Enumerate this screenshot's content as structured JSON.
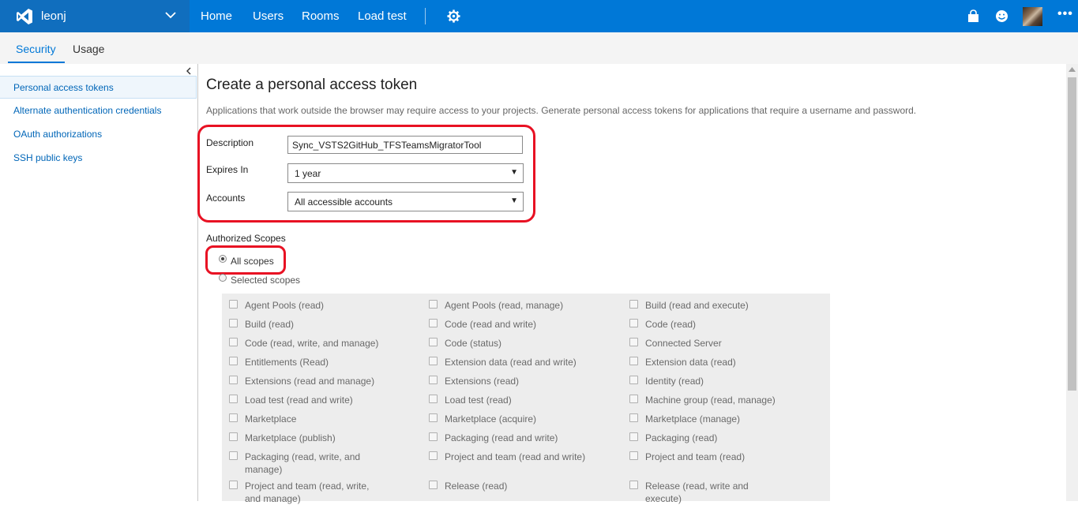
{
  "topbar": {
    "account_name": "leonj",
    "nav": [
      "Home",
      "Users",
      "Rooms",
      "Load test"
    ],
    "icons": [
      "visual-studio-logo",
      "chevron-down-icon",
      "gear-icon",
      "shopping-bag-icon",
      "smiley-feedback-icon",
      "avatar",
      "more-icon"
    ]
  },
  "subnav": {
    "tabs": [
      "Security",
      "Usage"
    ],
    "active": "Security"
  },
  "sidebar": {
    "items": [
      "Personal access tokens",
      "Alternate authentication credentials",
      "OAuth authorizations",
      "SSH public keys"
    ],
    "selected": "Personal access tokens"
  },
  "main": {
    "title": "Create a personal access token",
    "description": "Applications that work outside the browser may require access to your projects. Generate personal access tokens for applications that require a username and password.",
    "form": {
      "description_label": "Description",
      "description_value": "Sync_VSTS2GitHub_TFSTeamsMigratorTool",
      "expires_label": "Expires In",
      "expires_value": "1 year",
      "accounts_label": "Accounts",
      "accounts_value": "All accessible accounts"
    },
    "scopes_label": "Authorized Scopes",
    "radio_all": "All scopes",
    "radio_selected": "Selected scopes",
    "scope_items": [
      [
        "Agent Pools (read)",
        "Agent Pools (read, manage)",
        "Build (read and execute)"
      ],
      [
        "Build (read)",
        "Code (read and write)",
        "Code (read)"
      ],
      [
        "Code (read, write, and manage)",
        "Code (status)",
        "Connected Server"
      ],
      [
        "Entitlements (Read)",
        "Extension data (read and write)",
        "Extension data (read)"
      ],
      [
        "Extensions (read and manage)",
        "Extensions (read)",
        "Identity (read)"
      ],
      [
        "Load test (read and write)",
        "Load test (read)",
        "Machine group (read, manage)"
      ],
      [
        "Marketplace",
        "Marketplace (acquire)",
        "Marketplace (manage)"
      ],
      [
        "Marketplace (publish)",
        "Packaging (read and write)",
        "Packaging (read)"
      ],
      [
        "Packaging (read, write, and manage)",
        "Project and team (read and write)",
        "Project and team (read)"
      ],
      [
        "Project and team (read, write, and manage)",
        "Release (read)",
        "Release (read, write and execute)"
      ]
    ]
  },
  "colors": {
    "accent": "#0078d7",
    "account_bg": "#106ebe",
    "highlight": "#e81123"
  }
}
